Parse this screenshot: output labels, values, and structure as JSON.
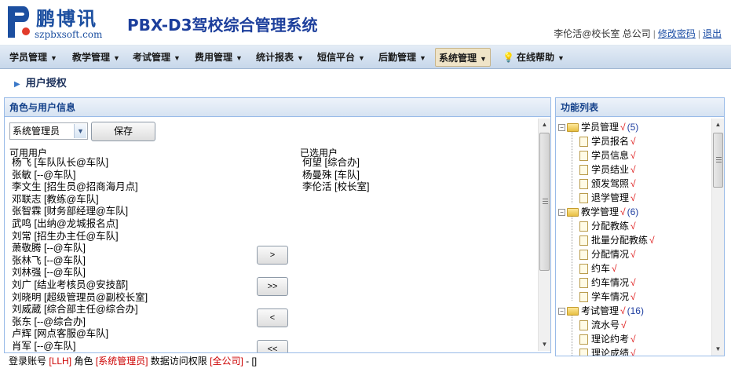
{
  "header": {
    "logo_text": "鹏博讯",
    "logo_url": "szpbxsoft.com",
    "system_title": "PBX-D3驾校综合管理系统",
    "user_info": "李伦活@校长室 总公司",
    "change_password": "修改密码",
    "logout": "退出"
  },
  "nav": {
    "items": [
      {
        "label": "学员管理"
      },
      {
        "label": "教学管理"
      },
      {
        "label": "考试管理"
      },
      {
        "label": "费用管理"
      },
      {
        "label": "统计报表"
      },
      {
        "label": "短信平台"
      },
      {
        "label": "后勤管理"
      },
      {
        "label": "系统管理"
      },
      {
        "label": "在线帮助"
      }
    ],
    "active_index": 7
  },
  "page": {
    "title": "用户授权"
  },
  "left_panel": {
    "title": "角色与用户信息",
    "role_select_value": "系统管理员",
    "save_label": "保存",
    "available_label": "可用用户",
    "selected_label": "已选用户",
    "available_users": [
      "杨飞 [车队队长@车队]",
      "张敏 [--@车队]",
      "李文生 [招生员@招商海月点]",
      "邓联志 [教练@车队]",
      "张智霖 [财务部经理@车队]",
      "武鸣 [出纳@龙城报名点]",
      "刘常 [招生办主任@车队]",
      "萧敬腾 [--@车队]",
      "张林飞 [--@车队]",
      "刘林强 [--@车队]",
      "刘广 [结业考核员@安技部]",
      "刘晓明 [超级管理员@副校长室]",
      "刘威葳 [综合部主任@综合办]",
      "张东 [--@综合办]",
      "卢辉 [网点客服@车队]",
      "肖军 [--@车队]"
    ],
    "selected_users": [
      "何望 [综合办]",
      "杨曼殊 [车队]",
      "李伦活 [校长室]"
    ],
    "move_buttons": [
      ">",
      ">>",
      "<",
      "<<"
    ]
  },
  "right_panel": {
    "title": "功能列表",
    "check_mark": "√",
    "tree": [
      {
        "label": "学员管理",
        "count": "(5)",
        "children": [
          "学员报名",
          "学员信息",
          "学员结业",
          "颁发驾照",
          "退学管理"
        ]
      },
      {
        "label": "教学管理",
        "count": "(6)",
        "children": [
          "分配教练",
          "批量分配教练",
          "分配情况",
          "约车",
          "约车情况",
          "学车情况"
        ]
      },
      {
        "label": "考试管理",
        "count": "(16)",
        "children": [
          "流水号",
          "理论约考",
          "理论成绩"
        ]
      }
    ]
  },
  "status": {
    "prefix": "登录账号",
    "account": "[LLH]",
    "role_prefix": "角色",
    "role": "[系统管理员]",
    "scope_prefix": "数据访问权限",
    "scope": "[全公司]",
    "suffix": "- []"
  }
}
